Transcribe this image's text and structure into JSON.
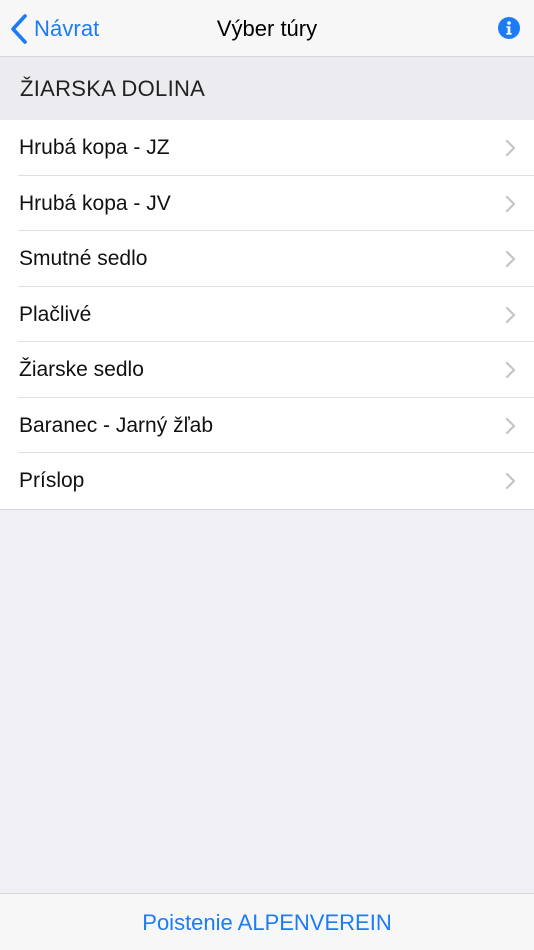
{
  "nav": {
    "back_label": "Návrat",
    "title": "Výber túry"
  },
  "section": {
    "title": "ŽIARSKA DOLINA"
  },
  "tours": [
    {
      "label": "Hrubá kopa - JZ"
    },
    {
      "label": "Hrubá kopa - JV"
    },
    {
      "label": "Smutné sedlo"
    },
    {
      "label": "Plačlivé"
    },
    {
      "label": "Žiarske sedlo"
    },
    {
      "label": "Baranec - Jarný žľab"
    },
    {
      "label": "Príslop"
    }
  ],
  "footer": {
    "insurance_label": "Poistenie ALPENVEREIN"
  },
  "colors": {
    "accent": "#1b7cf6",
    "background": "#efeff4",
    "section_header": "#ebebf0"
  },
  "icons": {
    "back": "chevron-left-icon",
    "info": "info-icon",
    "disclosure": "chevron-right-icon"
  }
}
